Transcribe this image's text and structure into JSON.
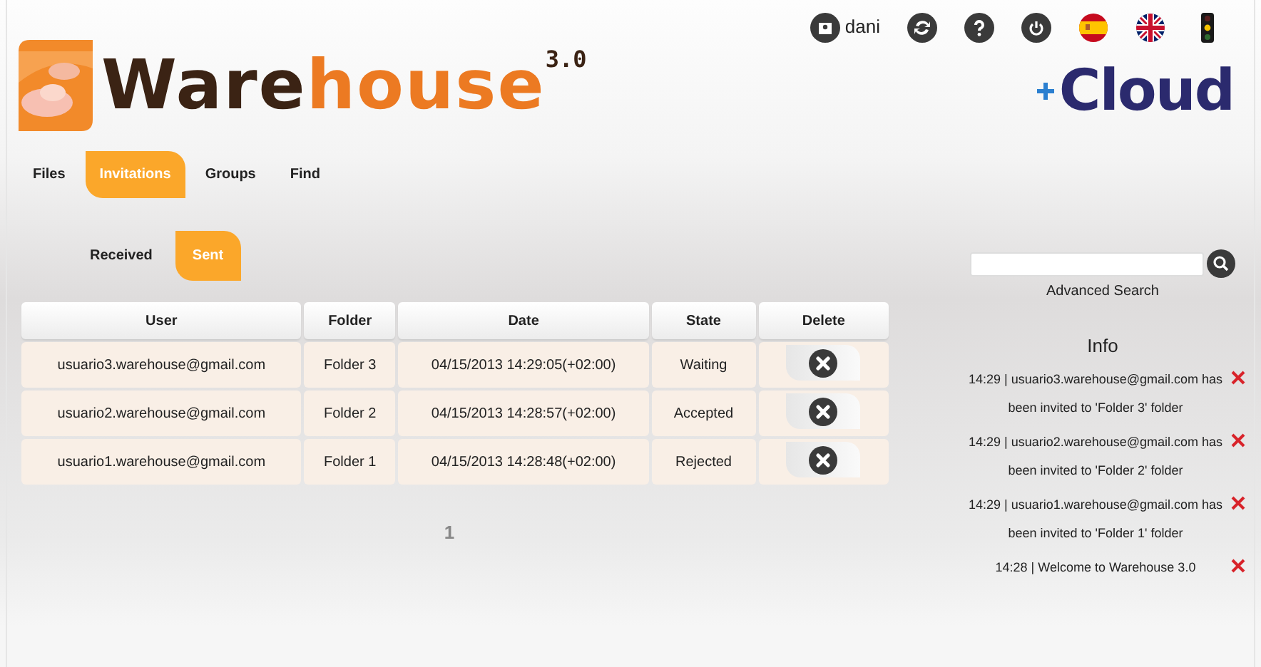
{
  "header": {
    "user": "dani",
    "icons": [
      {
        "kind": "user"
      },
      {
        "kind": "sync"
      },
      {
        "kind": "help"
      },
      {
        "kind": "power"
      },
      {
        "kind": "flag-es"
      },
      {
        "kind": "flag-uk"
      },
      {
        "kind": "traffic"
      }
    ],
    "logo": {
      "main": "Ware",
      "accent": "house",
      "version": "3.0"
    },
    "cloud_logo": "Cloud"
  },
  "tabs": [
    {
      "label": "Files",
      "selected": false
    },
    {
      "label": "Invitations",
      "selected": true
    },
    {
      "label": "Groups",
      "selected": false
    },
    {
      "label": "Find",
      "selected": false
    }
  ],
  "subtabs": [
    {
      "label": "Received",
      "selected": false
    },
    {
      "label": "Sent",
      "selected": true
    }
  ],
  "table": {
    "columns": [
      "User",
      "Folder",
      "Date",
      "State",
      "Delete"
    ],
    "rows": [
      {
        "user": "usuario3.warehouse@gmail.com",
        "folder": "Folder 3",
        "date": "04/15/2013 14:29:05(+02:00)",
        "state": "Waiting"
      },
      {
        "user": "usuario2.warehouse@gmail.com",
        "folder": "Folder 2",
        "date": "04/15/2013 14:28:57(+02:00)",
        "state": "Accepted"
      },
      {
        "user": "usuario1.warehouse@gmail.com",
        "folder": "Folder 1",
        "date": "04/15/2013 14:28:48(+02:00)",
        "state": "Rejected"
      }
    ]
  },
  "pagination": [
    "1"
  ],
  "search": {
    "link": "Advanced Search"
  },
  "info": {
    "title": "Info",
    "messages": [
      "14:29 | usuario3.warehouse@gmail.com has been invited to 'Folder 3' folder",
      "14:29 | usuario2.warehouse@gmail.com has been invited to 'Folder 2' folder",
      "14:29 | usuario1.warehouse@gmail.com has been invited to 'Folder 1' folder",
      "14:28 | Welcome to Warehouse 3.0"
    ]
  }
}
